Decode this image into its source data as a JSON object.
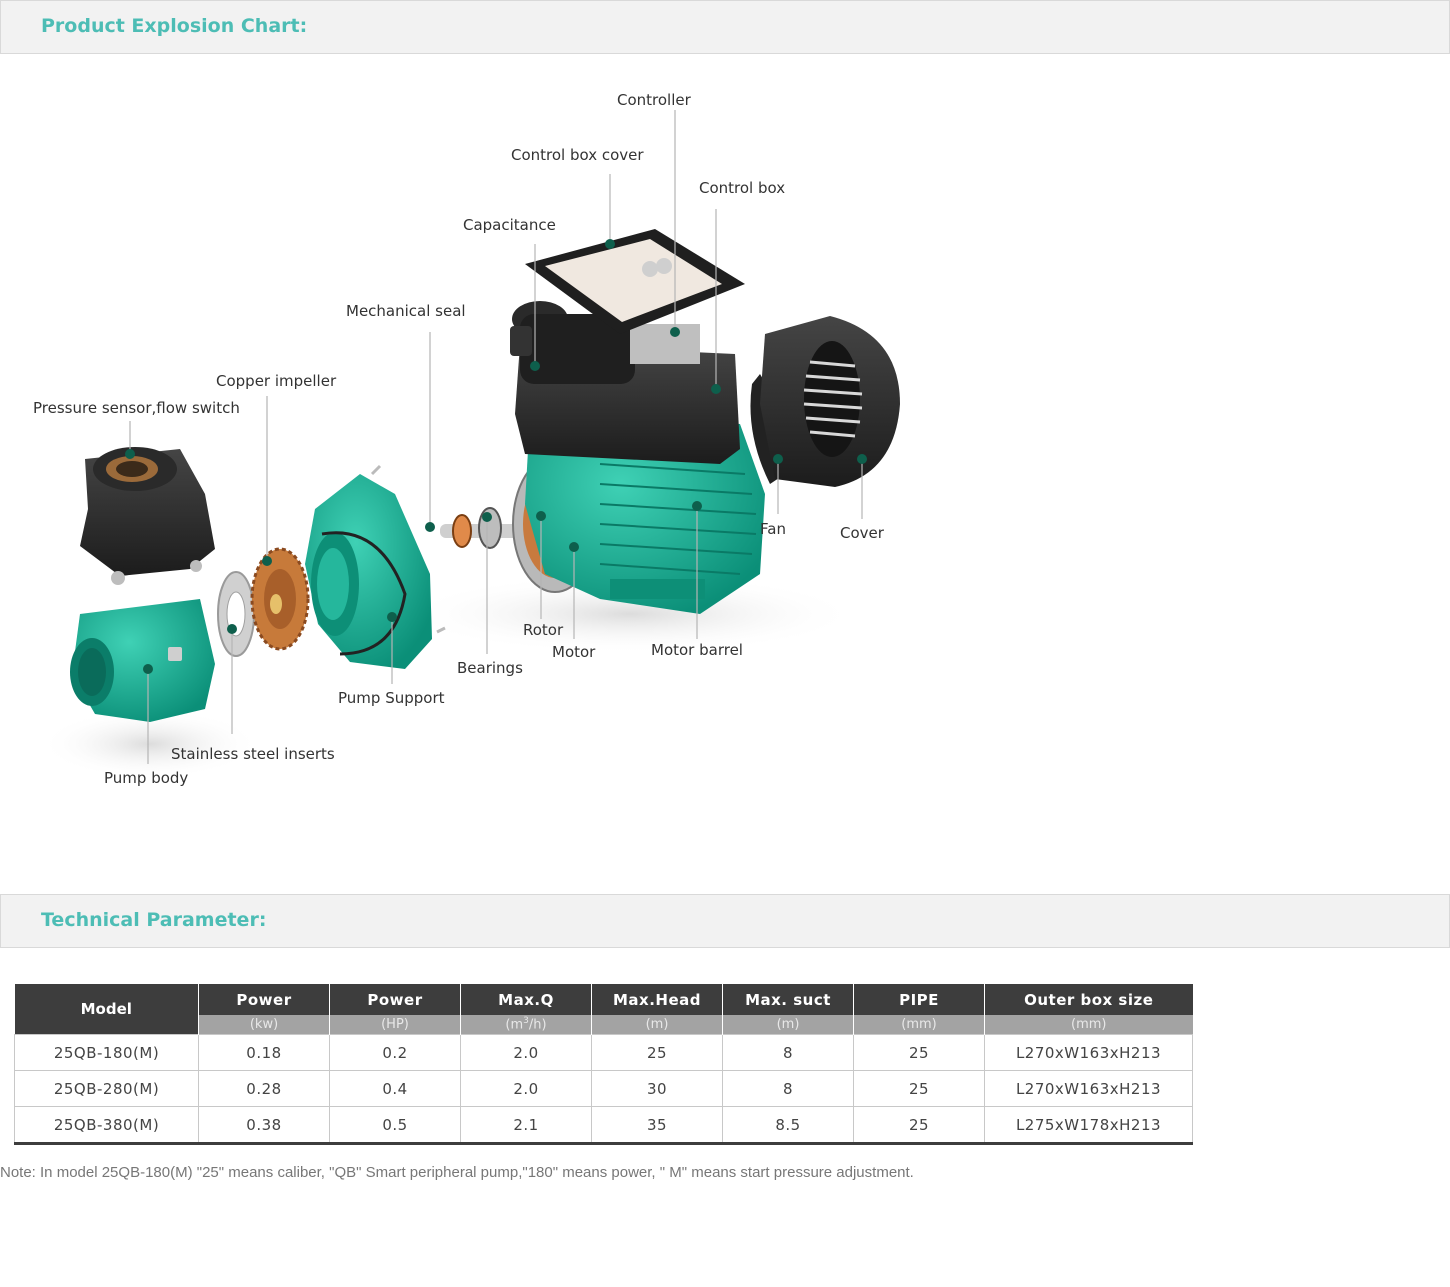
{
  "section1": {
    "title": "Product Explosion Chart:"
  },
  "diagram": {
    "labels": {
      "controller": "Controller",
      "control_box_cover": "Control box cover",
      "control_box": "Control box",
      "capacitance": "Capacitance",
      "mechanical_seal": "Mechanical seal",
      "copper_impeller": "Copper impeller",
      "pressure_sensor": "Pressure sensor,flow switch",
      "fan": "Fan",
      "cover": "Cover",
      "rotor": "Rotor",
      "motor": "Motor",
      "motor_barrel": "Motor barrel",
      "bearings": "Bearings",
      "pump_support": "Pump Support",
      "stainless_inserts": "Stainless steel inserts",
      "pump_body": "Pump body"
    },
    "colors": {
      "pump_green": "#14a58d",
      "dark_plastic": "#2b2b2b",
      "copper": "#c77a3a",
      "leader_dot": "#0e5f4c"
    }
  },
  "section2": {
    "title": "Technical Parameter:"
  },
  "table": {
    "headers": {
      "model": "Model",
      "power_kw": "Power",
      "power_kw_unit": "(kw)",
      "power_hp": "Power",
      "power_hp_unit": "(HP)",
      "maxq": "Max.Q",
      "maxq_unit_pre": "(m",
      "maxq_unit_sup": "3",
      "maxq_unit_post": "/h)",
      "maxhead": "Max.Head",
      "maxhead_unit": "(m)",
      "maxsuct": "Max. suct",
      "maxsuct_unit": "(m)",
      "pipe": "PIPE",
      "pipe_unit": "(mm)",
      "box": "Outer box size",
      "box_unit": "(mm)"
    },
    "rows": [
      [
        "25QB-180(M)",
        "0.18",
        "0.2",
        "2.0",
        "25",
        "8",
        "25",
        "L270xW163xH213"
      ],
      [
        "25QB-280(M)",
        "0.28",
        "0.4",
        "2.0",
        "30",
        "8",
        "25",
        "L270xW163xH213"
      ],
      [
        "25QB-380(M)",
        "0.38",
        "0.5",
        "2.1",
        "35",
        "8.5",
        "25",
        "L275xW178xH213"
      ]
    ]
  },
  "note": "Note: In model 25QB-180(M) \"25\" means caliber, \"QB\" Smart peripheral pump,\"180\" means power, \" M\" means start pressure adjustment."
}
